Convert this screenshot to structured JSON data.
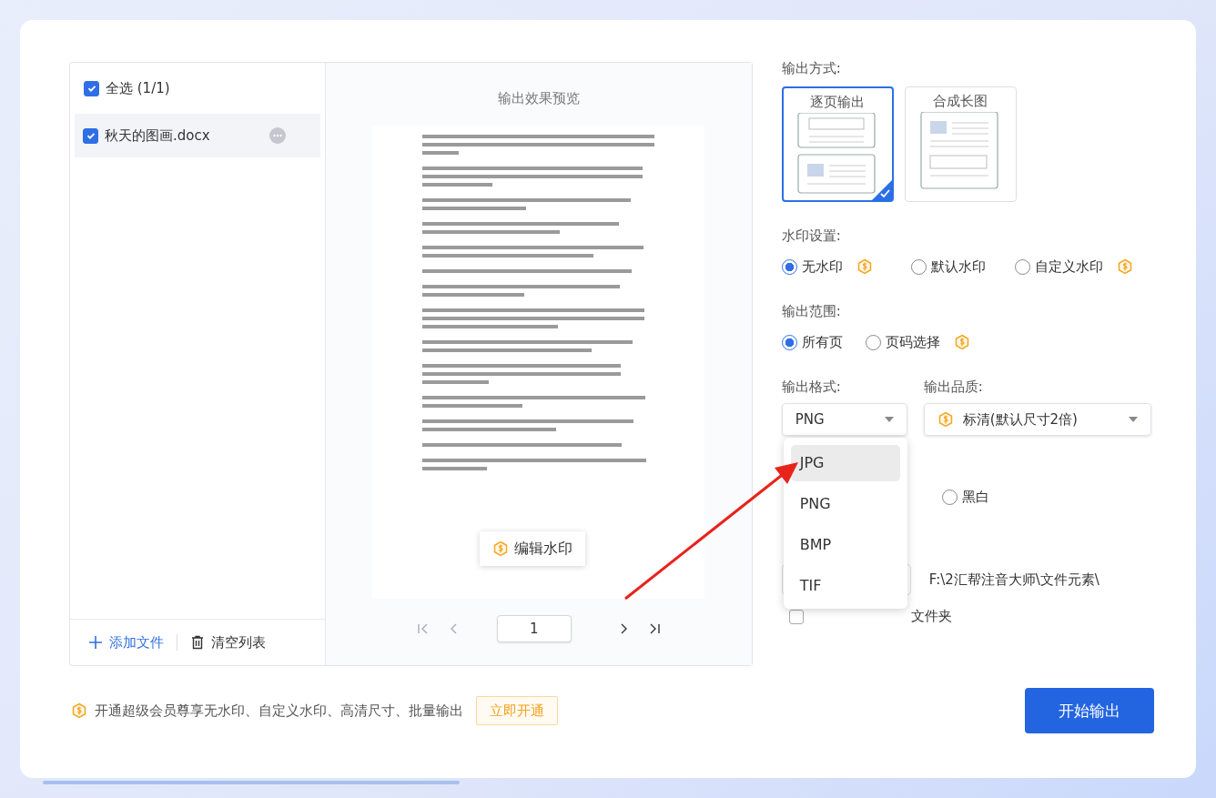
{
  "file_list": {
    "select_all": {
      "label": "全选 (1/1)",
      "checked": true
    },
    "files": [
      {
        "name": "秋天的图画.docx",
        "checked": true,
        "selected": true
      }
    ],
    "add_button": "添加文件",
    "clear_button": "清空列表"
  },
  "preview": {
    "title": "输出效果预览",
    "edit_watermark": "编辑水印",
    "page_number": "1"
  },
  "output_mode": {
    "label": "输出方式:",
    "options": [
      {
        "label": "逐页输出",
        "kind": "pages",
        "selected": true
      },
      {
        "label": "合成长图",
        "kind": "long",
        "selected": false
      }
    ]
  },
  "watermark": {
    "label": "水印设置:",
    "options": [
      {
        "label": "无水印",
        "selected": true,
        "premium": true
      },
      {
        "label": "默认水印",
        "selected": false,
        "premium": false
      },
      {
        "label": "自定义水印",
        "selected": false,
        "premium": true
      }
    ]
  },
  "range": {
    "label": "输出范围:",
    "options": [
      {
        "label": "所有页",
        "selected": true,
        "premium": false
      },
      {
        "label": "页码选择",
        "selected": false,
        "premium": true
      }
    ]
  },
  "format": {
    "label": "输出格式:",
    "value": "PNG",
    "menu": [
      {
        "label": "JPG",
        "highlighted": true
      },
      {
        "label": "PNG",
        "highlighted": false
      },
      {
        "label": "BMP",
        "highlighted": false
      },
      {
        "label": "TIF",
        "highlighted": false
      }
    ]
  },
  "quality": {
    "label": "输出品质:",
    "value": "标清(默认尺寸2倍)",
    "premium": true
  },
  "color": {
    "options": [
      {
        "label": "黑白",
        "selected": false
      }
    ]
  },
  "output_path": "F:\\2汇帮注音大师\\文件元素\\",
  "subfolder": {
    "label": "文件夹",
    "checked": false
  },
  "promo": {
    "text": "开通超级会员尊享无水印、自定义水印、高清尺寸、批量输出",
    "button": "立即开通"
  },
  "start_button": "开始输出"
}
